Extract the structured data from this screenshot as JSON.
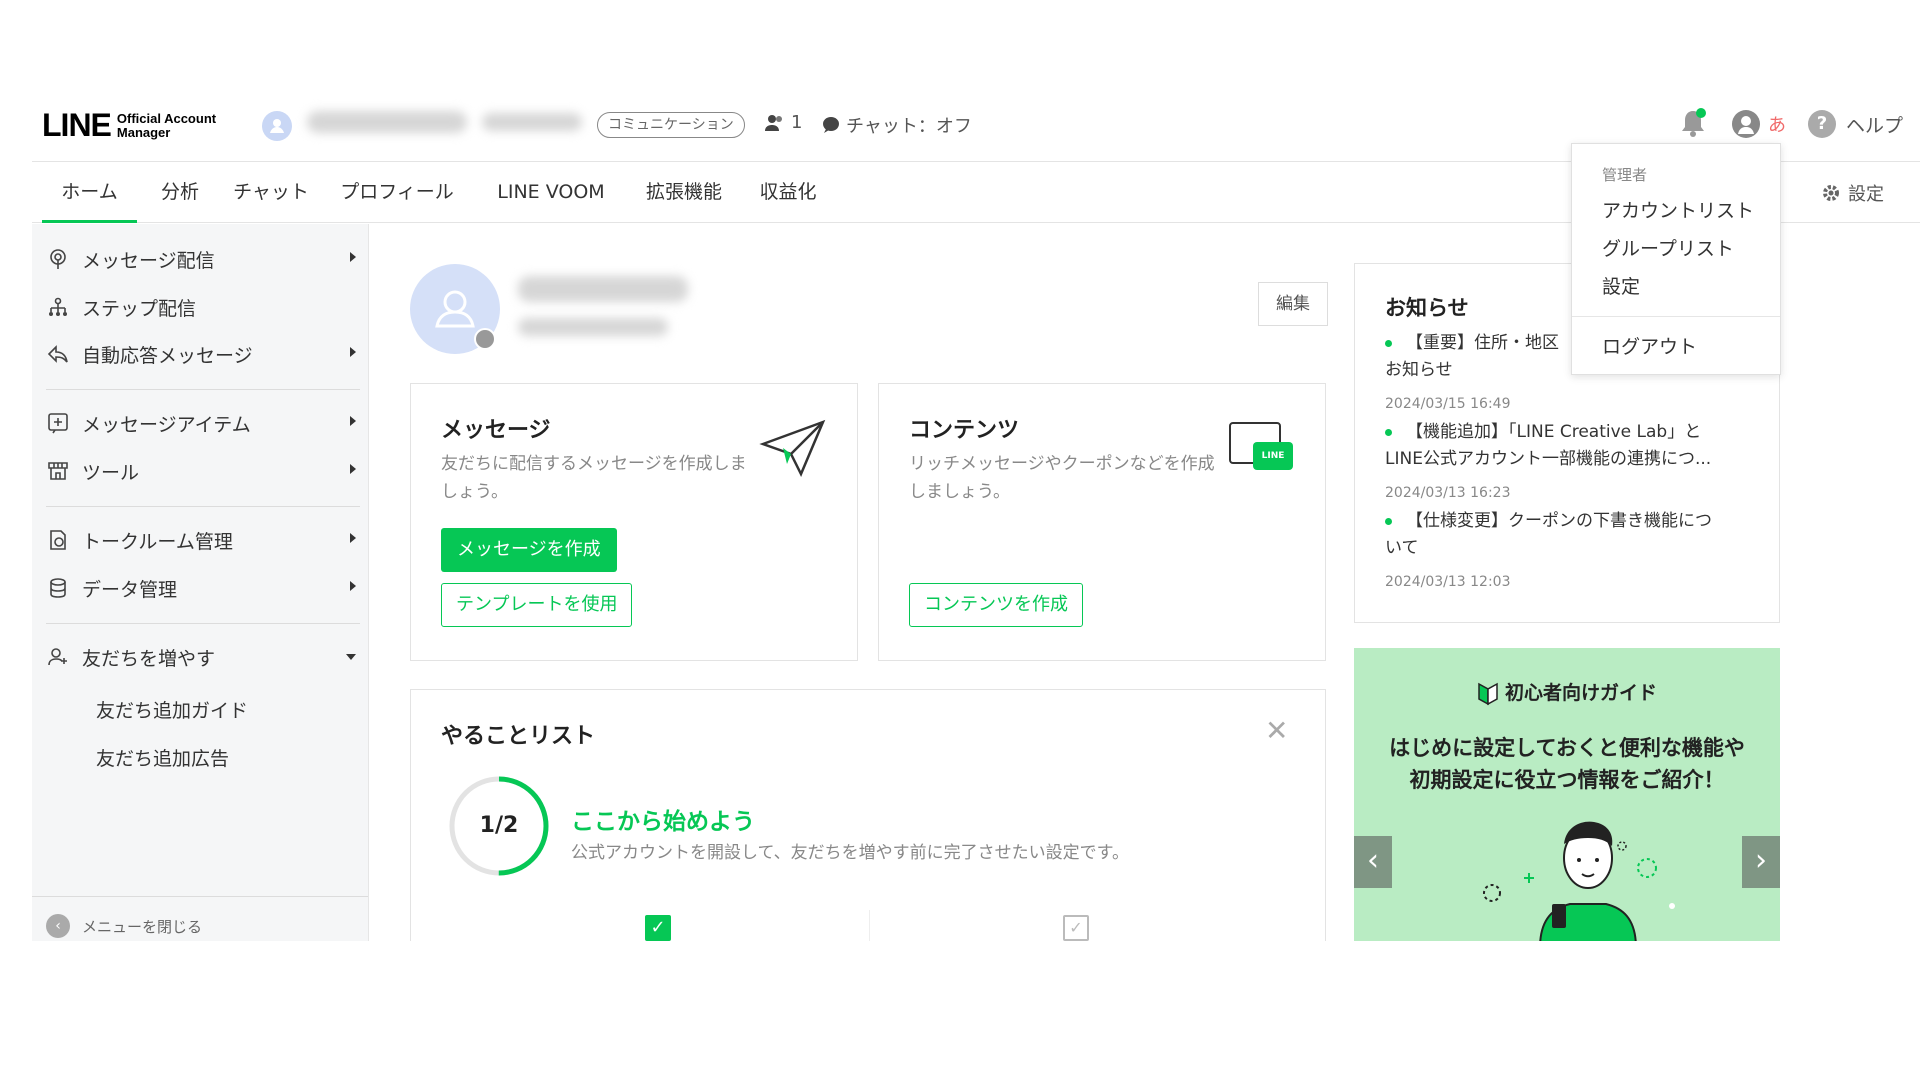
{
  "header": {
    "logo_main": "LINE",
    "logo_sub_line1": "Official Account",
    "logo_sub_line2": "Manager",
    "plan_badge": "コミュニケーション",
    "friends_count": "1",
    "chat_status": "チャット：オフ",
    "user_initial": "あ",
    "help_label": "ヘルプ",
    "settings_label": "設定"
  },
  "tabs": [
    {
      "label": "ホーム",
      "active": true
    },
    {
      "label": "分析"
    },
    {
      "label": "チャット"
    },
    {
      "label": "プロフィール"
    },
    {
      "label": "LINE VOOM"
    },
    {
      "label": "拡張機能"
    },
    {
      "label": "収益化"
    }
  ],
  "sidebar": {
    "items": [
      {
        "label": "メッセージ配信",
        "icon": "broadcast-icon"
      },
      {
        "label": "ステップ配信",
        "icon": "step-tree-icon"
      },
      {
        "label": "自動応答メッセージ",
        "icon": "reply-icon"
      },
      {
        "label": "メッセージアイテム",
        "icon": "plus-square-icon"
      },
      {
        "label": "ツール",
        "icon": "store-icon"
      },
      {
        "label": "トークルーム管理",
        "icon": "chatroom-icon"
      },
      {
        "label": "データ管理",
        "icon": "database-icon"
      },
      {
        "label": "友だちを増やす",
        "icon": "add-friend-icon"
      }
    ],
    "subitems": [
      "友だち追加ガイド",
      "友だち追加広告"
    ],
    "close_menu": "メニューを閉じる"
  },
  "profile": {
    "edit_label": "編集"
  },
  "message_card": {
    "title": "メッセージ",
    "desc": "友だちに配信するメッセージを作成しましょう。",
    "primary_button": "メッセージを作成",
    "secondary_button": "テンプレートを使用"
  },
  "content_card": {
    "title": "コンテンツ",
    "desc": "リッチメッセージやクーポンなどを作成しましょう。",
    "button": "コンテンツを作成",
    "icon_text": "LINE"
  },
  "todo": {
    "title": "やることリスト",
    "progress_text": "1/2",
    "progress": 0.5,
    "heading": "ここから始めよう",
    "desc": "公式アカウントを開設して、友だちを増やす前に完了させたい設定です。"
  },
  "news": {
    "title": "お知らせ",
    "items": [
      {
        "text": "【重要】住所・地区",
        "text2": "お知らせ",
        "date": "2024/03/15 16:49"
      },
      {
        "text": "【機能追加】「LINE Creative Lab」と",
        "text2": "LINE公式アカウント一部機能の連携につ...",
        "date": "2024/03/13 16:23"
      },
      {
        "text": "【仕様変更】クーポンの下書き機能につ",
        "text2": "いて",
        "date": "2024/03/13 12:03"
      }
    ]
  },
  "dropdown": {
    "section": "管理者",
    "items": [
      "アカウントリスト",
      "グループリスト",
      "設定"
    ],
    "logout": "ログアウト"
  },
  "banner": {
    "badge": "初心者向けガイド",
    "line1": "はじめに設定しておくと便利な機能や",
    "line2": "初期設定に役立つ情報をご紹介！"
  },
  "colors": {
    "accent": "#06c755",
    "sidebar_bg": "#f5f6f7",
    "banner_bg": "#b9ecc3"
  }
}
